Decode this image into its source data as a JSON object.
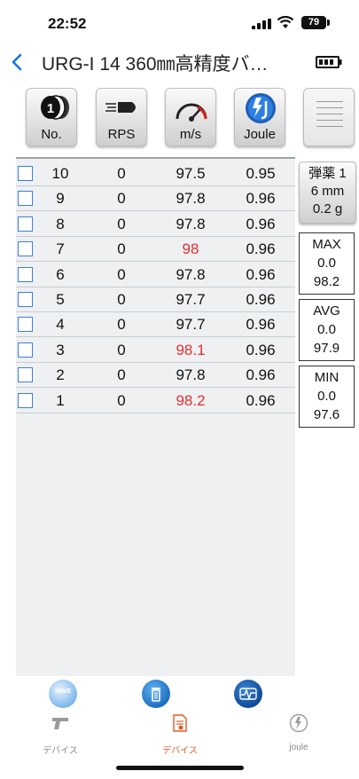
{
  "status_bar": {
    "time": "22:52",
    "battery": "79"
  },
  "nav": {
    "title": "URG-I 14 360㎜高精度バ…"
  },
  "toolbar": {
    "buttons": [
      {
        "label": "No.",
        "icon": "coins-icon"
      },
      {
        "label": "RPS",
        "icon": "bullet-icon"
      },
      {
        "label": "m/s",
        "icon": "speedometer-icon"
      },
      {
        "label": "Joule",
        "icon": "joule-icon"
      },
      {
        "label": "",
        "icon": "menu-icon"
      }
    ]
  },
  "table": {
    "rows": [
      {
        "no": "10",
        "rps": "0",
        "ms": "97.5",
        "joule": "0.95",
        "highlight": false
      },
      {
        "no": "9",
        "rps": "0",
        "ms": "97.8",
        "joule": "0.96",
        "highlight": false
      },
      {
        "no": "8",
        "rps": "0",
        "ms": "97.8",
        "joule": "0.96",
        "highlight": false
      },
      {
        "no": "7",
        "rps": "0",
        "ms": "98",
        "joule": "0.96",
        "highlight": true
      },
      {
        "no": "6",
        "rps": "0",
        "ms": "97.8",
        "joule": "0.96",
        "highlight": false
      },
      {
        "no": "5",
        "rps": "0",
        "ms": "97.7",
        "joule": "0.96",
        "highlight": false
      },
      {
        "no": "4",
        "rps": "0",
        "ms": "97.7",
        "joule": "0.96",
        "highlight": false
      },
      {
        "no": "3",
        "rps": "0",
        "ms": "98.1",
        "joule": "0.96",
        "highlight": true
      },
      {
        "no": "2",
        "rps": "0",
        "ms": "97.8",
        "joule": "0.96",
        "highlight": false
      },
      {
        "no": "1",
        "rps": "0",
        "ms": "98.2",
        "joule": "0.96",
        "highlight": true
      }
    ]
  },
  "side": {
    "ammo": {
      "line1": "弾薬 1",
      "line2": "6 mm",
      "line3": "0.2 g"
    },
    "stats": [
      {
        "label": "MAX",
        "rps": "0.0",
        "ms": "98.2"
      },
      {
        "label": "AVG",
        "rps": "0.0",
        "ms": "97.9"
      },
      {
        "label": "MIN",
        "rps": "0.0",
        "ms": "97.6"
      }
    ]
  },
  "actions": {
    "save_label": "SAVE"
  },
  "tabs": [
    {
      "label": "デバイス",
      "icon": "pistol-icon"
    },
    {
      "label": "デバイス",
      "icon": "report-icon"
    },
    {
      "label": "joule",
      "icon": "joule-tab-icon"
    }
  ],
  "colors": {
    "accent": "#1a73e8",
    "highlight": "#e03030",
    "active_tab": "#e05a20"
  }
}
